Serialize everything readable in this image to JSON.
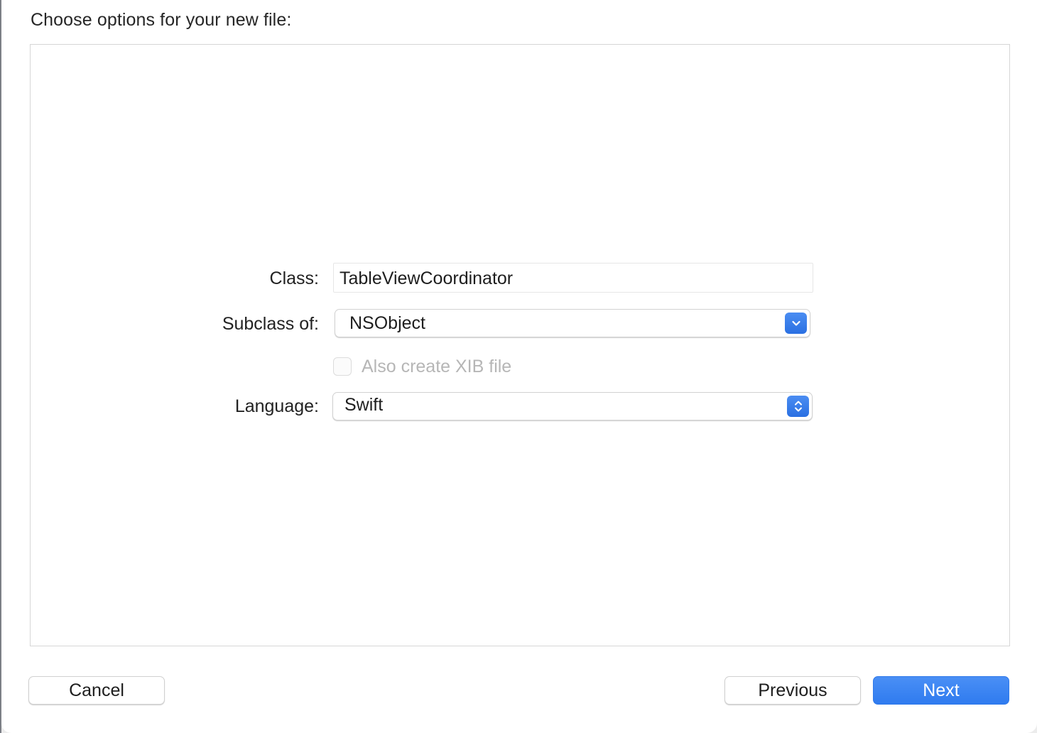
{
  "dialog": {
    "title": "Choose options for your new file:"
  },
  "form": {
    "class_label": "Class:",
    "class_value": "TableViewCoordinator",
    "subclass_label": "Subclass of:",
    "subclass_value": "NSObject",
    "subclass_icon": "chevron-down-icon",
    "xib_checkbox_label": "Also create XIB file",
    "xib_checked": false,
    "xib_enabled": false,
    "language_label": "Language:",
    "language_value": "Swift",
    "language_icon": "up-down-chevron-icon"
  },
  "buttons": {
    "cancel": "Cancel",
    "previous": "Previous",
    "next": "Next"
  },
  "colors": {
    "accent": "#2f7bef",
    "disabled_text": "#b6b6b6"
  }
}
